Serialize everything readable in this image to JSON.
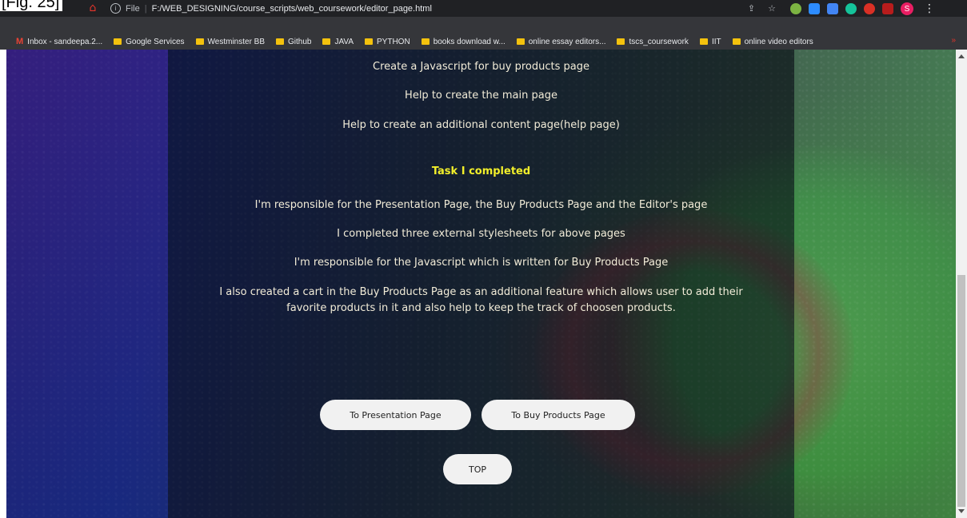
{
  "figure_label": "[Fig. 25]",
  "browser": {
    "url_scheme": "File",
    "url": "F:/WEB_DESIGNING/course_scripts/web_coursework/editor_page.html",
    "avatar_letter": "S",
    "bookmarks": [
      {
        "label": "Inbox - sandeepa.2...",
        "icon": "gmail-icon"
      },
      {
        "label": "Google Services",
        "icon": "folder-icon"
      },
      {
        "label": "Westminster BB",
        "icon": "folder-icon"
      },
      {
        "label": "Github",
        "icon": "folder-icon"
      },
      {
        "label": "JAVA",
        "icon": "folder-icon"
      },
      {
        "label": "PYTHON",
        "icon": "folder-icon"
      },
      {
        "label": "books download w...",
        "icon": "folder-icon"
      },
      {
        "label": "online essay editors...",
        "icon": "folder-icon"
      },
      {
        "label": "tscs_coursework",
        "icon": "folder-icon"
      },
      {
        "label": "IIT",
        "icon": "folder-icon"
      },
      {
        "label": "online video editors",
        "icon": "folder-icon"
      }
    ],
    "bookmarks_more": "»"
  },
  "page": {
    "tasks_top": [
      "Create a Javascript for buy products page",
      "Help to create the main page",
      "Help to create an additional content page(help page)"
    ],
    "completed_heading": "Task I completed",
    "completed_items": [
      "I'm responsible for the Presentation Page, the Buy Products Page and the Editor's page",
      "I completed three external stylesheets for above pages",
      "I'm responsible for the Javascript which is written for Buy Products Page"
    ],
    "completed_extra_line1": "I also created a cart in the Buy Products Page as an additional feature which allows user to add their",
    "completed_extra_line2": "favorite products in it and also help to keep the track of choosen products.",
    "buttons": {
      "presentation": "To Presentation Page",
      "buy_products": "To Buy Products Page",
      "top": "TOP"
    }
  }
}
